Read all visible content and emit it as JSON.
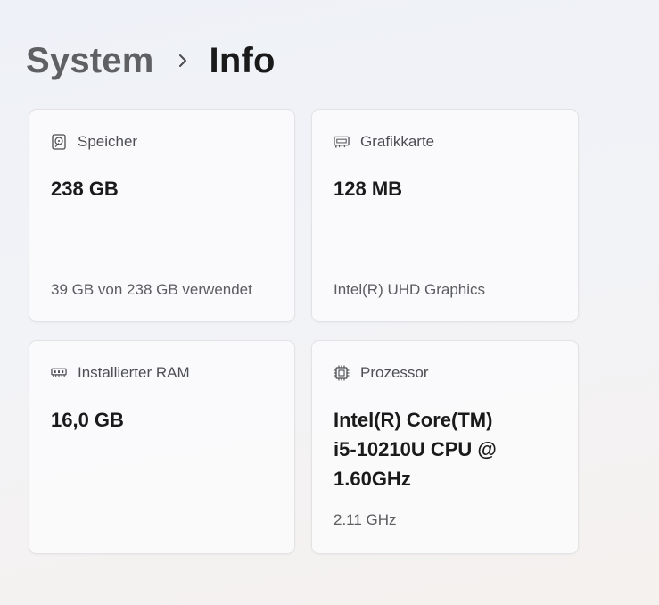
{
  "breadcrumb": {
    "parent": "System",
    "current": "Info"
  },
  "cards": {
    "storage": {
      "title": "Speicher",
      "value": "238 GB",
      "sub": "39 GB von 238 GB verwendet",
      "icon": "hard-drive-icon"
    },
    "graphics": {
      "title": "Grafikkarte",
      "value": "128 MB",
      "sub": "Intel(R) UHD Graphics",
      "icon": "graphics-card-icon"
    },
    "ram": {
      "title": "Installierter RAM",
      "value": "16,0 GB",
      "icon": "ram-icon"
    },
    "processor": {
      "title": "Prozessor",
      "value_lines": [
        "Intel(R) Core(TM)",
        "i5-10210U CPU @",
        "1.60GHz"
      ],
      "sub": "2.11 GHz",
      "icon": "processor-icon"
    }
  },
  "colors": {
    "card_border": "#e3e3e6",
    "text_primary": "#1a1a1a",
    "text_secondary": "#5c5d60"
  }
}
